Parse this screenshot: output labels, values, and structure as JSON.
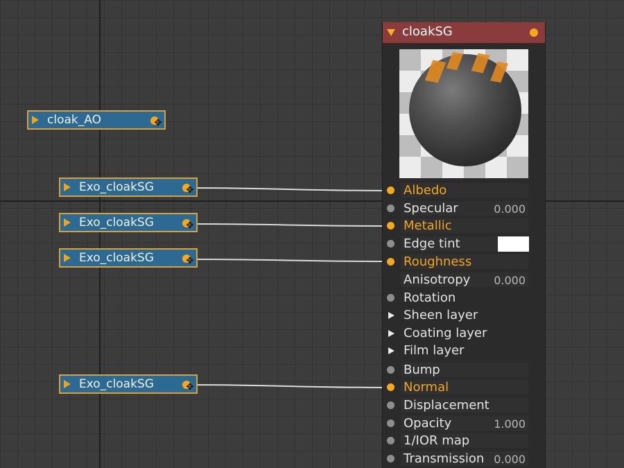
{
  "source_nodes": [
    {
      "label": "cloak_AO"
    },
    {
      "label": "Exo_cloakSG"
    },
    {
      "label": "Exo_cloakSG"
    },
    {
      "label": "Exo_cloakSG"
    },
    {
      "label": "Exo_cloakSG"
    }
  ],
  "material_node": {
    "title": "cloakSG",
    "header_color": "#8a3b3b",
    "parameters": [
      {
        "name": "Albedo",
        "connected": true
      },
      {
        "name": "Specular",
        "value": "0.000"
      },
      {
        "name": "Metallic",
        "connected": true
      },
      {
        "name": "Edge tint",
        "swatch": "#ffffff"
      },
      {
        "name": "Roughness",
        "connected": true
      },
      {
        "name": "Anisotropy",
        "value": "0.000"
      },
      {
        "name": "Rotation"
      },
      {
        "name": "Sheen layer",
        "expandable": true
      },
      {
        "name": "Coating layer",
        "expandable": true
      },
      {
        "name": "Film layer",
        "expandable": true
      },
      {
        "name": "Bump"
      },
      {
        "name": "Normal",
        "connected": true
      },
      {
        "name": "Displacement"
      },
      {
        "name": "Opacity",
        "value": "1.000"
      },
      {
        "name": "1/IOR map"
      },
      {
        "name": "Transmission",
        "value": "0.000"
      }
    ]
  },
  "connections": [
    {
      "from": "Exo_cloakSG",
      "to": "Albedo"
    },
    {
      "from": "Exo_cloakSG",
      "to": "Metallic"
    },
    {
      "from": "Exo_cloakSG",
      "to": "Roughness"
    },
    {
      "from": "Exo_cloakSG",
      "to": "Normal"
    }
  ],
  "colors": {
    "source_node_fill": "#2d6a93",
    "selection_outline": "#d9a13a",
    "connected_port": "#f5a81c",
    "connected_label": "#f2a623"
  },
  "icons": {
    "collapse": "triangle-right-icon",
    "material_collapse": "triangle-down-icon",
    "output_port": "output-port-icon",
    "move": "move-cross-icon"
  }
}
